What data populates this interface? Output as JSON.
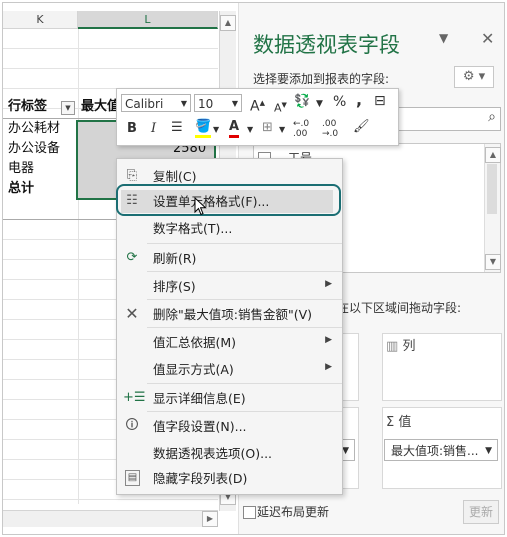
{
  "sheet": {
    "columns": [
      "K",
      "L"
    ],
    "header": {
      "row_label": "行标签",
      "value_label": "最大值"
    },
    "rows": [
      "办公耗材",
      "办公设备",
      "电器"
    ],
    "total_label": "总计",
    "value_cell": "2580"
  },
  "mini_toolbar": {
    "font": "Calibri",
    "size": "10",
    "grow": "A",
    "shrink": "A",
    "percent": "%",
    "comma": ",",
    "bold": "B",
    "italic": "I",
    "font_color_letter": "A",
    "inc_decimal": "←.0 .00",
    "dec_decimal": ".00 →.0"
  },
  "context_menu": {
    "items": [
      {
        "label": "复制(C)",
        "icon": "copy-icon"
      },
      {
        "label": "设置单元格格式(F)...",
        "icon": "format-cells-icon",
        "highlighted": true
      },
      {
        "label": "数字格式(T)...",
        "icon": ""
      },
      {
        "label": "刷新(R)",
        "icon": "refresh-icon"
      },
      {
        "label": "排序(S)",
        "icon": "",
        "submenu": true
      },
      {
        "label": "删除\"最大值项:销售金额\"(V)",
        "icon": "delete-x-icon"
      },
      {
        "label": "值汇总依据(M)",
        "icon": "",
        "submenu": true
      },
      {
        "label": "值显示方式(A)",
        "icon": "",
        "submenu": true
      },
      {
        "label": "显示详细信息(E)",
        "icon": "show-details-icon"
      },
      {
        "label": "值字段设置(N)...",
        "icon": "value-field-settings-icon"
      },
      {
        "label": "数据透视表选项(O)...",
        "icon": ""
      },
      {
        "label": "隐藏字段列表(D)",
        "icon": "hide-field-list-icon"
      }
    ]
  },
  "pane": {
    "title": "数据透视表字段",
    "subtitle": "选择要添加到报表的字段:",
    "field_first": "工号",
    "areas_label": "在以下区域间拖动字段:",
    "columns_label": "列",
    "values_label": "值",
    "value_chip": "最大值项:销售...",
    "defer_label": "延迟布局更新",
    "update_label": "更新"
  },
  "colors": {
    "accent": "#217346",
    "callout": "#1b6e73"
  }
}
